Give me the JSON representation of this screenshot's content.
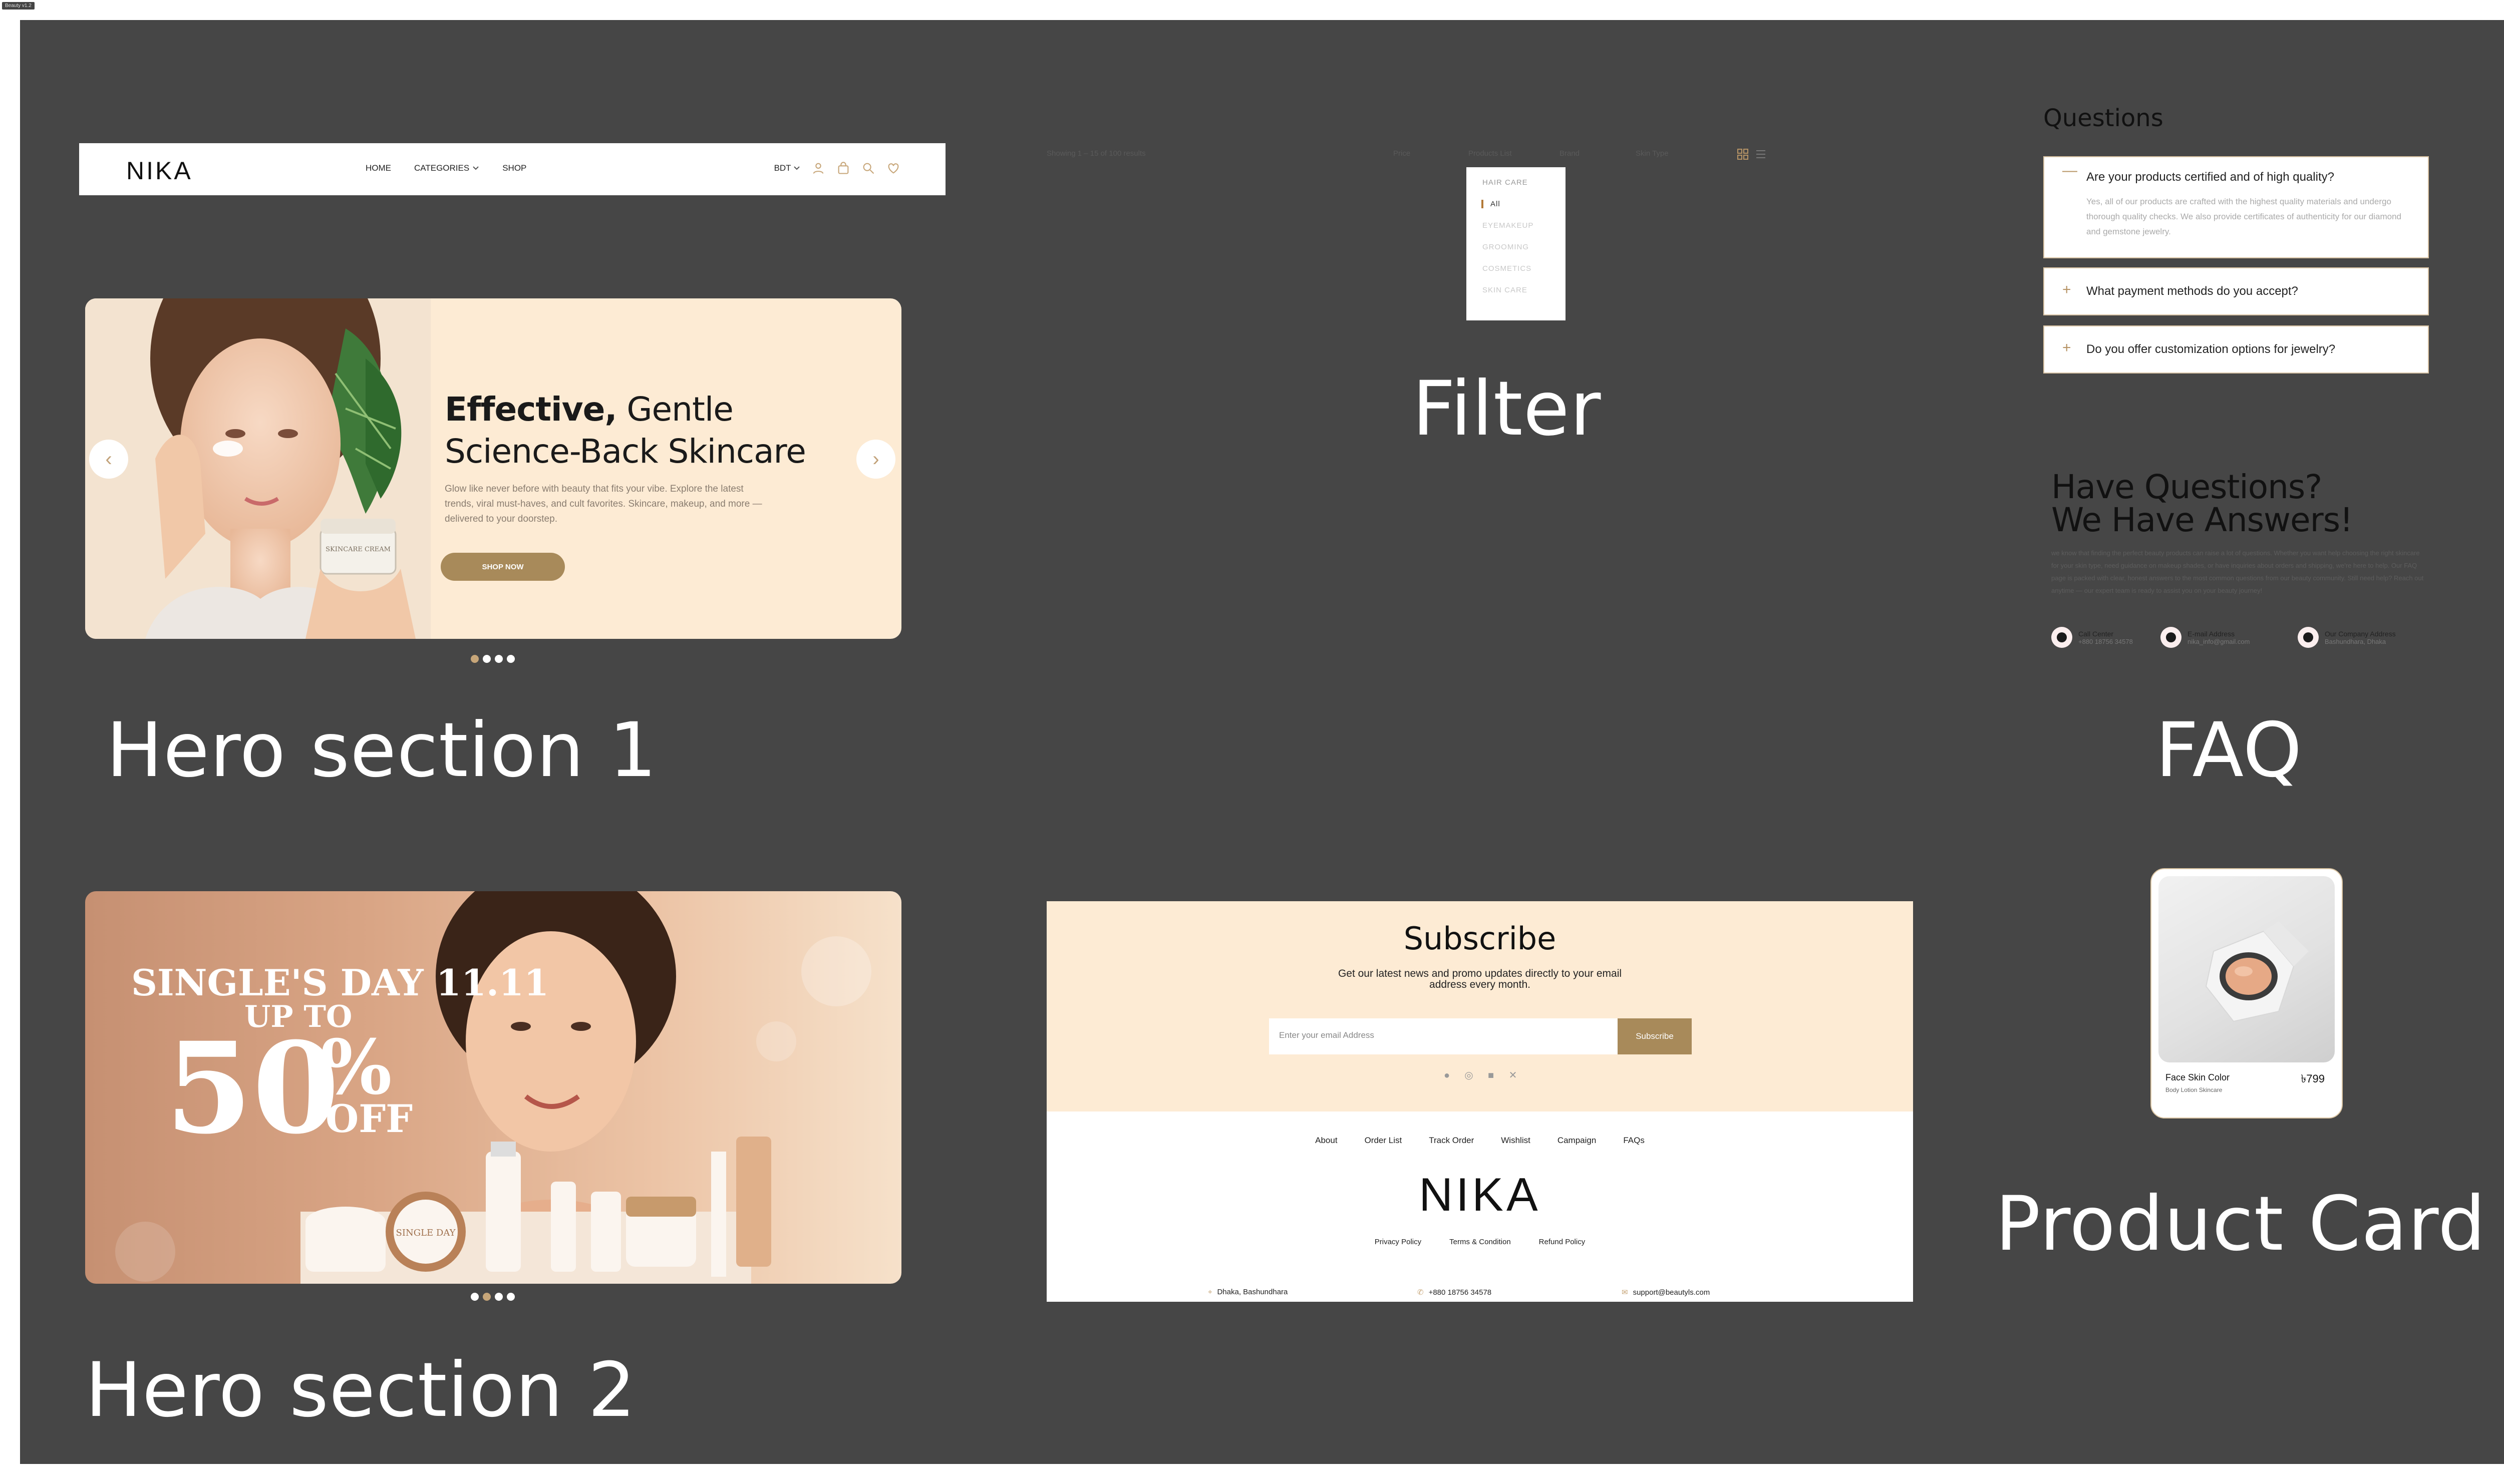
{
  "frame_tag": "Beauty v1.2",
  "labels": {
    "hero1": "Hero section 1",
    "hero2": "Hero section 2",
    "filter": "Filter",
    "faq": "FAQ",
    "product_card": "Product Card"
  },
  "nav": {
    "logo": "NIKA",
    "links": [
      "HOME",
      "CATEGORIES",
      "SHOP"
    ],
    "currency": "BDT"
  },
  "hero1": {
    "title_bold": "Effective,",
    "title_rest": " Gentle",
    "title_line2": "Science-Back Skincare",
    "description": "Glow like never before with beauty that fits your vibe. Explore the latest trends, viral must-haves, and cult favorites. Skincare, makeup, and more — delivered to your doorstep.",
    "cta": "SHOP NOW",
    "jar_label": "SKINCARE CREAM",
    "slides": 4,
    "active_slide": 0
  },
  "hero2": {
    "line1": "SINGLE'S DAY 11.11",
    "line2": "UP TO",
    "big_number": "50",
    "percent": "%",
    "off": "OFF",
    "jar_label": "SINGLE DAY",
    "slides": 4,
    "active_slide": 1
  },
  "filter": {
    "results": "Showing 1 – 15 of 100 results",
    "price": "Price",
    "products_list": "Products List",
    "brand": "Brand",
    "skin_type": "Skin Type",
    "dropdown": {
      "group": "HAIR CARE",
      "selected": "All",
      "options": [
        "EYEMAKEUP",
        "GROOMING",
        "COSMETICS",
        "SKIN CARE"
      ]
    }
  },
  "faq": {
    "title": "Questions",
    "items": [
      {
        "question": "Are your products certified and of high quality?",
        "answer": "Yes, all of our products are crafted with the highest quality materials and undergo thorough quality checks. We also provide certificates of authenticity for our diamond and gemstone jewelry.",
        "open": true
      },
      {
        "question": "What payment methods do you accept?",
        "open": false
      },
      {
        "question": "Do you offer customization options for jewelry?",
        "open": false
      }
    ],
    "heading_line1": "Have Questions?",
    "heading_line2": "We Have Answers!",
    "body": "we know that finding the perfect beauty products can raise a lot of questions. Whether you want help choosing the right skincare for your skin type, need guidance on makeup shades, or have inquiries about orders and shipping, we're here to help. Our FAQ page is packed with clear, honest answers to the most common questions from our beauty community. Still need help? Reach out anytime — our expert team is ready to assist you on your beauty journey!",
    "contacts": [
      {
        "title": "Call Center",
        "value": "+880 18756 34578"
      },
      {
        "title": "E-mail Address",
        "value": "nika_info@gmail.com"
      },
      {
        "title": "Our Company Address",
        "value": "Bashundhara, Dhaka"
      }
    ]
  },
  "subscribe": {
    "title": "Subscribe",
    "text": "Get our latest news and promo updates directly to your email address every month.",
    "placeholder": "Enter your email Address",
    "button": "Subscribe"
  },
  "footer": {
    "links": [
      "About",
      "Order List",
      "Track Order",
      "Wishlist",
      "Campaign",
      "FAQs"
    ],
    "logo": "NIKA",
    "policies": [
      "Privacy Policy",
      "Terms & Condition",
      "Refund Policy"
    ],
    "address": "Dhaka, Bashundhara",
    "phone": "+880 18756 34578",
    "email": "support@beautyls.com"
  },
  "product_card": {
    "name": "Face Skin Color",
    "subtitle": "Body Lotion Skincare",
    "price": "৳799"
  },
  "colors": {
    "background": "#464646",
    "cream": "#fdebd4",
    "accent": "#a88a5a",
    "gold_dot": "#c7a679"
  }
}
